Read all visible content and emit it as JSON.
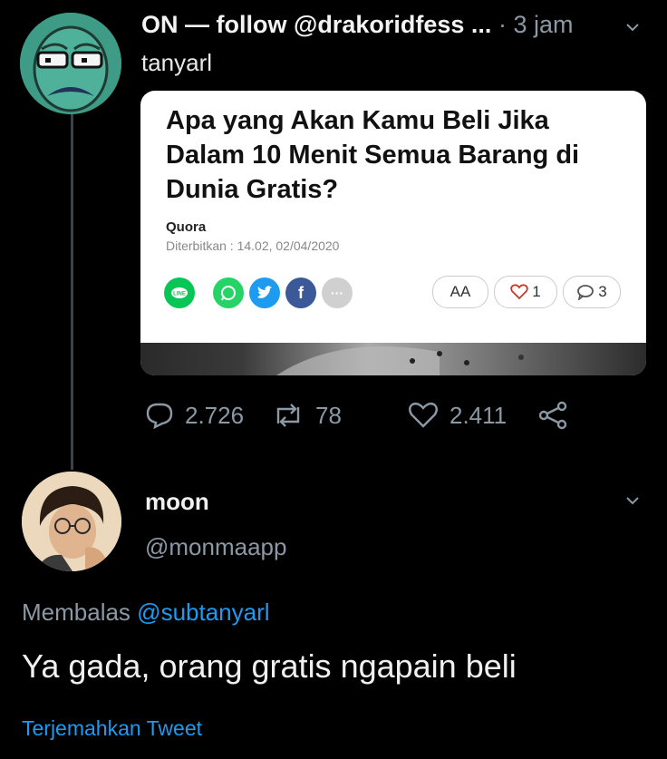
{
  "tweet1": {
    "display_name": "ON — follow @drakoridfess",
    "ellipsis": "...",
    "separator": "·",
    "time": "3 jam",
    "handle": "tanyarl",
    "card": {
      "title": "Apa yang Akan Kamu Beli Jika Dalam 10 Menit Semua Barang di Dunia Gratis?",
      "source": "Quora",
      "published": "Diterbitkan : 14.02, 02/04/2020",
      "font_size_label": "AA",
      "likes": "1",
      "comments": "3",
      "share_icons": [
        "line-icon",
        "whatsapp-icon",
        "twitter-icon",
        "facebook-icon",
        "more-icon"
      ]
    },
    "stats": {
      "replies": "2.726",
      "retweets": "78",
      "likes": "2.411"
    }
  },
  "tweet2": {
    "display_name": "moon",
    "handle": "@monmaapp",
    "reply_prefix": "Membalas",
    "reply_mention": "@subtanyarl",
    "text": "Ya gada, orang gratis ngapain beli",
    "translate": "Terjemahkan Tweet"
  },
  "colors": {
    "background": "#000000",
    "accent": "#1d9bf0",
    "muted": "#8b98a5"
  }
}
